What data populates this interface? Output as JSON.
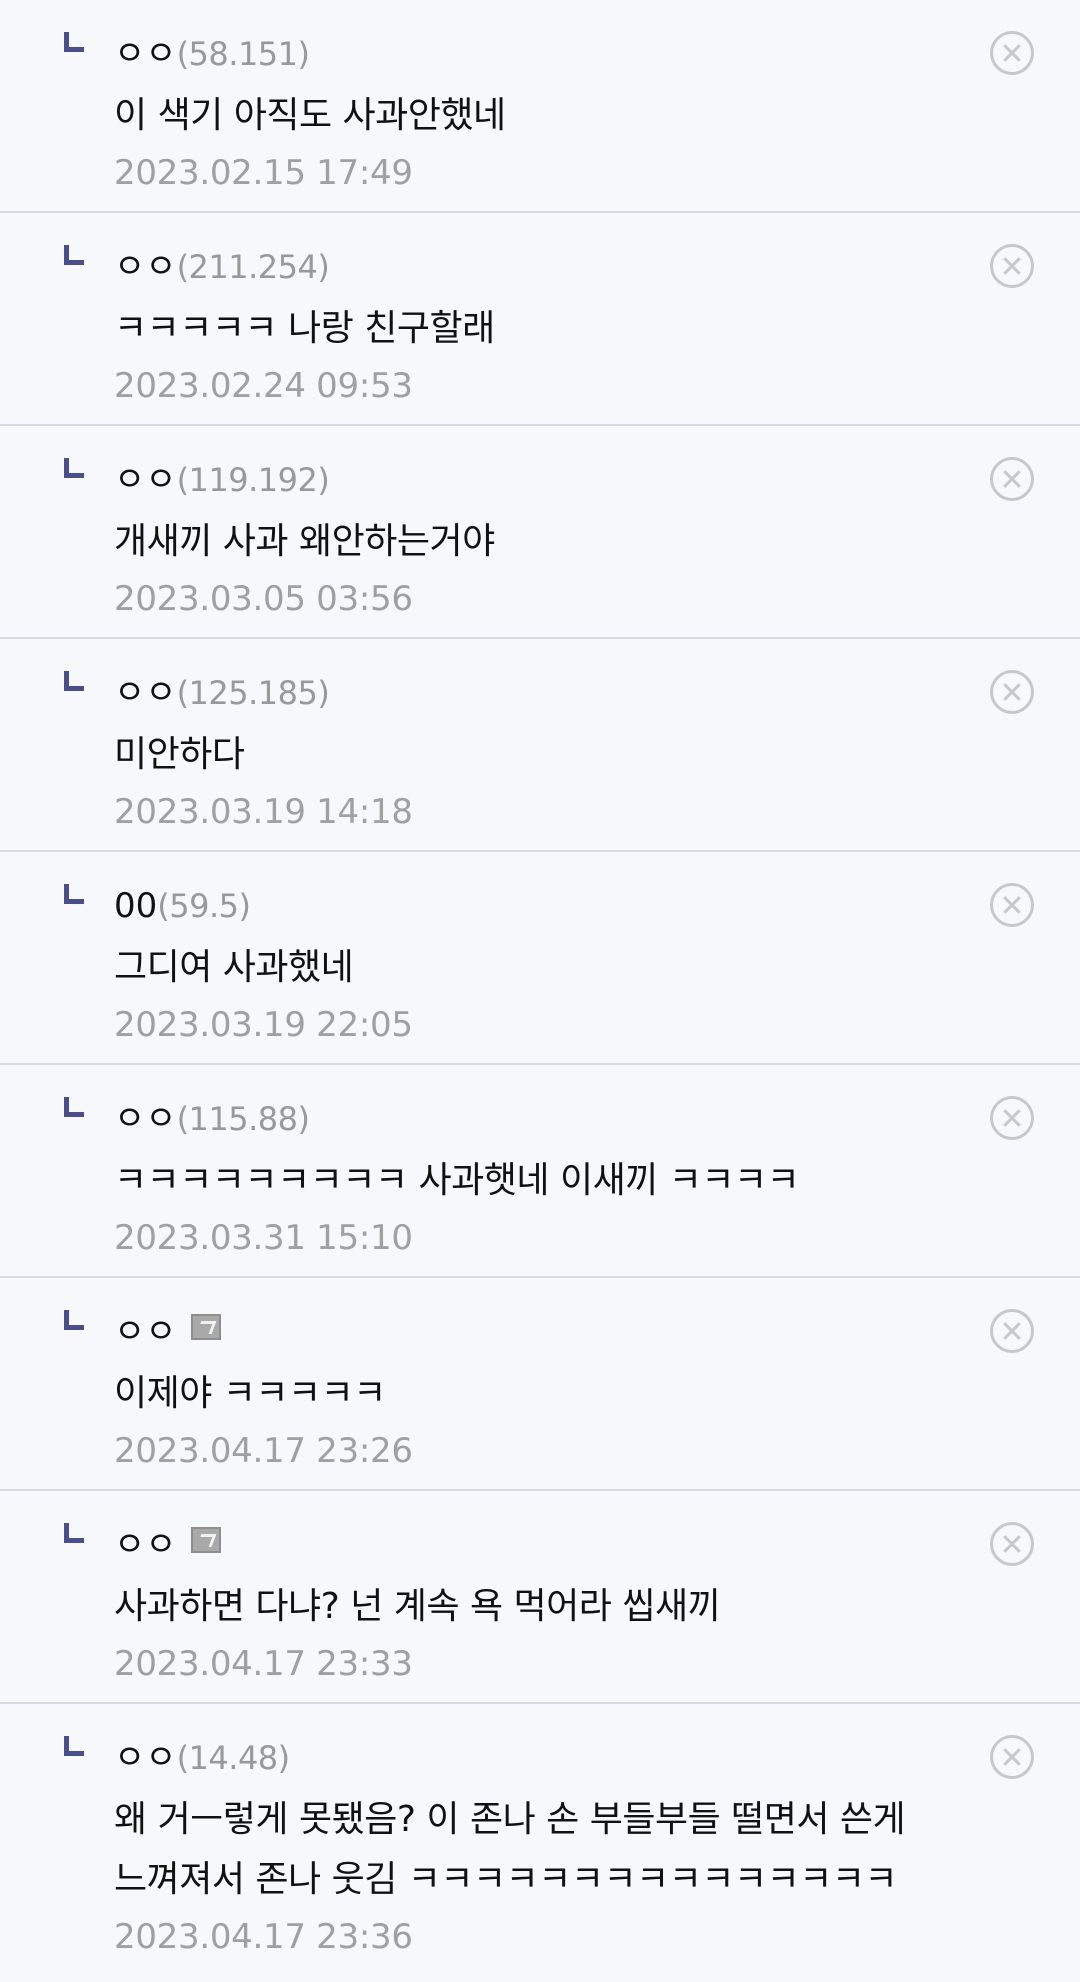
{
  "comments": [
    {
      "nickname": "ㅇㅇ",
      "ip": "(58.151)",
      "text": "이 색기 아직도 사과안했네",
      "date": "2023.02.15 17:49"
    },
    {
      "nickname": "ㅇㅇ",
      "ip": "(211.254)",
      "text": "ㅋㅋㅋㅋㅋ 나랑 친구할래",
      "date": "2023.02.24 09:53"
    },
    {
      "nickname": "ㅇㅇ",
      "ip": "(119.192)",
      "text": "개새끼 사과 왜안하는거야",
      "date": "2023.03.05 03:56"
    },
    {
      "nickname": "ㅇㅇ",
      "ip": "(125.185)",
      "text": "미안하다",
      "date": "2023.03.19 14:18"
    },
    {
      "nickname": "00",
      "ip": "(59.5)",
      "text": "그디여 사과했네",
      "date": "2023.03.19 22:05"
    },
    {
      "nickname": "ㅇㅇ",
      "ip": "(115.88)",
      "text": "ㅋㅋㅋㅋㅋㅋㅋㅋㅋ 사과햇네 이새끼 ㅋㅋㅋㅋ",
      "date": "2023.03.31 15:10"
    },
    {
      "nickname": "ㅇㅇ",
      "ip": "",
      "text": "이제야 ㅋㅋㅋㅋㅋ",
      "date": "2023.04.17 23:26",
      "member_icon": "member-badge-icon"
    },
    {
      "nickname": "ㅇㅇ",
      "ip": "",
      "text": "사과하면 다냐? 넌 계속 욕 먹어라 씹새끼",
      "date": "2023.04.17 23:33",
      "member_icon": "member-badge-icon"
    },
    {
      "nickname": "ㅇㅇ",
      "ip": "(14.48)",
      "text": "왜 거ㅡ렇게 못됐음? 이 존나 손 부들부들 떨면서 쓴게 느껴져서 존나 웃김 ㅋㅋㅋㅋㅋㅋㅋㅋㅋㅋㅋㅋㅋㅋㅋ",
      "date": "2023.04.17 23:36"
    }
  ],
  "colors": {
    "background": "#f7f8fb",
    "divider": "#d7dae6",
    "reply_marker": "#4a4f8c",
    "meta_gray": "#a0a0a0",
    "delete_icon": "#c8c8c8"
  },
  "icons": {
    "reply": "reply-arrow-icon",
    "delete": "close-circle-icon",
    "member": "member-badge-icon"
  }
}
